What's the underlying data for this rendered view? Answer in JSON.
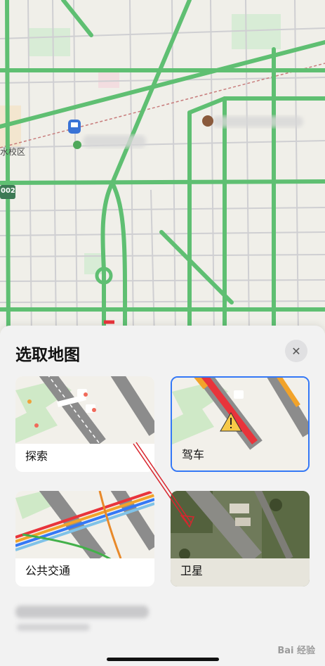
{
  "map": {
    "district_label": "水校区",
    "road_shield": "002"
  },
  "sheet": {
    "title": "选取地图",
    "close_label": "✕",
    "options": [
      {
        "label": "探索",
        "selected": false
      },
      {
        "label": "驾车",
        "selected": true
      },
      {
        "label": "公共交通",
        "selected": false
      },
      {
        "label": "卫星",
        "selected": false
      }
    ]
  },
  "colors": {
    "accent": "#3478f6",
    "traffic_green": "#5fbf72",
    "traffic_red": "#e8343b",
    "annotation_arrow": "#d8262e"
  },
  "watermark": {
    "text": "Bai 经验"
  }
}
